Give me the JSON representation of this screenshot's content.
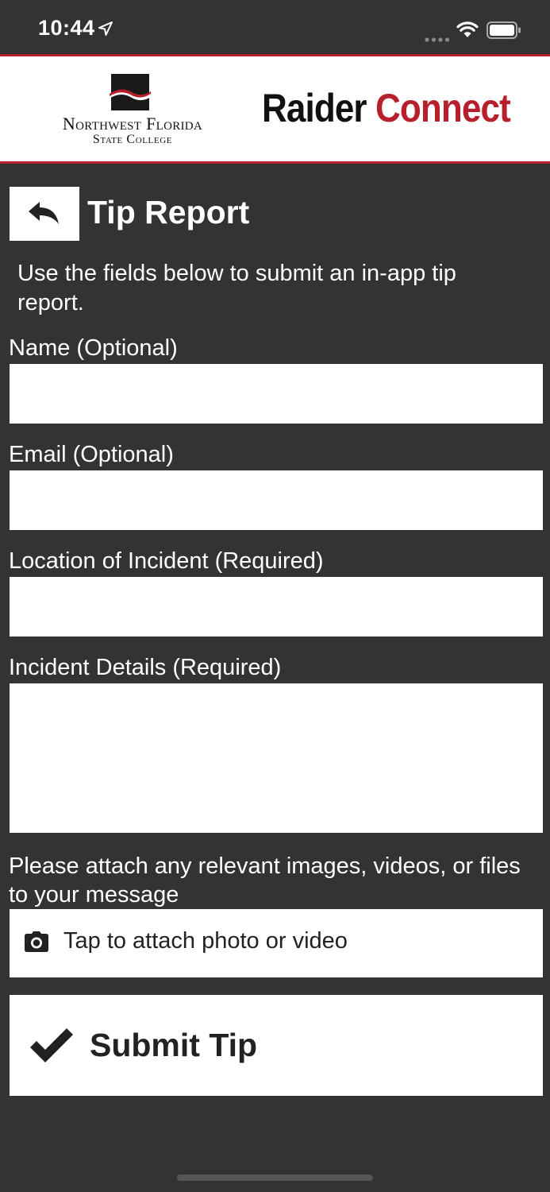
{
  "status_bar": {
    "time": "10:44"
  },
  "header": {
    "logo_line1": "Northwest Florida",
    "logo_line2": "State College",
    "brand_part1": "Raider",
    "brand_part2": "Connect",
    "accent_color": "#b61f2b"
  },
  "page": {
    "title": "Tip Report",
    "intro": "Use the fields below to submit an in-app tip report."
  },
  "form": {
    "name_label": "Name (Optional)",
    "name_value": "",
    "email_label": "Email (Optional)",
    "email_value": "",
    "location_label": "Location of Incident (Required)",
    "location_value": "",
    "details_label": "Incident Details (Required)",
    "details_value": "",
    "attach_prompt": "Please attach any relevant images, videos, or files to your message",
    "attach_button_label": "Tap to attach photo or video",
    "submit_label": "Submit Tip"
  },
  "icons": {
    "back": "back-arrow-icon",
    "camera": "camera-icon",
    "submit": "checkmark-icon"
  }
}
